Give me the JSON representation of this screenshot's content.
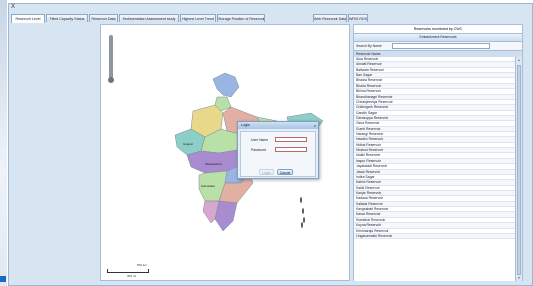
{
  "window": {
    "close_glyph": "X"
  },
  "tabs": [
    {
      "label": "Reservoir Level"
    },
    {
      "label": "Filled Capacity Status"
    },
    {
      "label": "Reservoir Data"
    },
    {
      "label": "Sedimentation Assessment study"
    },
    {
      "label": "Highest Level Trend"
    },
    {
      "label": "Storage Position of Reservoirs"
    },
    {
      "label": "Web Reservoir Data"
    },
    {
      "label": "WRIS RDS"
    }
  ],
  "map": {
    "state_labels": [
      "Gujarat",
      "Maharashtra",
      "Karnataka"
    ],
    "scale_top": "500 km",
    "scale_bottom": "300 mi",
    "colors": {
      "teal": "#8ccfc6",
      "pink": "#d7a7cf",
      "lightgreen": "#b8e0a7",
      "purple": "#a88ccf",
      "yellow": "#e8d88a",
      "blue": "#99b5e3",
      "salmon": "#e2b0a2"
    }
  },
  "panel": {
    "title": "Reservoirs monitored by CWC",
    "subtitle": "Embankment Reservoirs",
    "search_label": "Search By Name",
    "search_value": "",
    "column_header": "Reservoir Name",
    "items": [
      "Alua Reservoir",
      "Almatti Reservoir",
      "Baliwala Reservoir",
      "Ban Sagar",
      "Bhadra Reservoir",
      "Bhaira Reservoir",
      "Bhima Reservoir",
      "Bhandhanagri Reservoir",
      "Chiranjeevilya Reservoir",
      "Chittorgarh Reservoir",
      "Gandhi Sagar",
      "Gerasoppa Reservoir",
      "Gima Reservoir",
      "Gumti Reservoir",
      "Harangi Reservoir",
      "Hasdeo Reservoir",
      "Hidkal Reservoir",
      "Hirakud Reservoir",
      "Idukki Reservoir",
      "Isapur Reservoir",
      "Jayakwadi Reservoir",
      "Jawai Reservoir",
      "Indira Sagar",
      "Kabini Reservoir",
      "Kakki Reservoir",
      "Kanjar Reservoir",
      "Kadana Reservoir",
      "Kallada Reservoir",
      "Kangsabati Reservoir",
      "Kanar Reservoir",
      "Kiansthal Reservoir",
      "Koyna Reservoir",
      "Krishnaraja Reservoir",
      "Linganamakki Reservoir"
    ]
  },
  "dialog": {
    "title": "Login",
    "close_glyph": "x",
    "username_label": "User Name",
    "username_value": "",
    "password_label": "Password",
    "password_value": "",
    "login_label": "Login",
    "cancel_label": "Cancel"
  }
}
